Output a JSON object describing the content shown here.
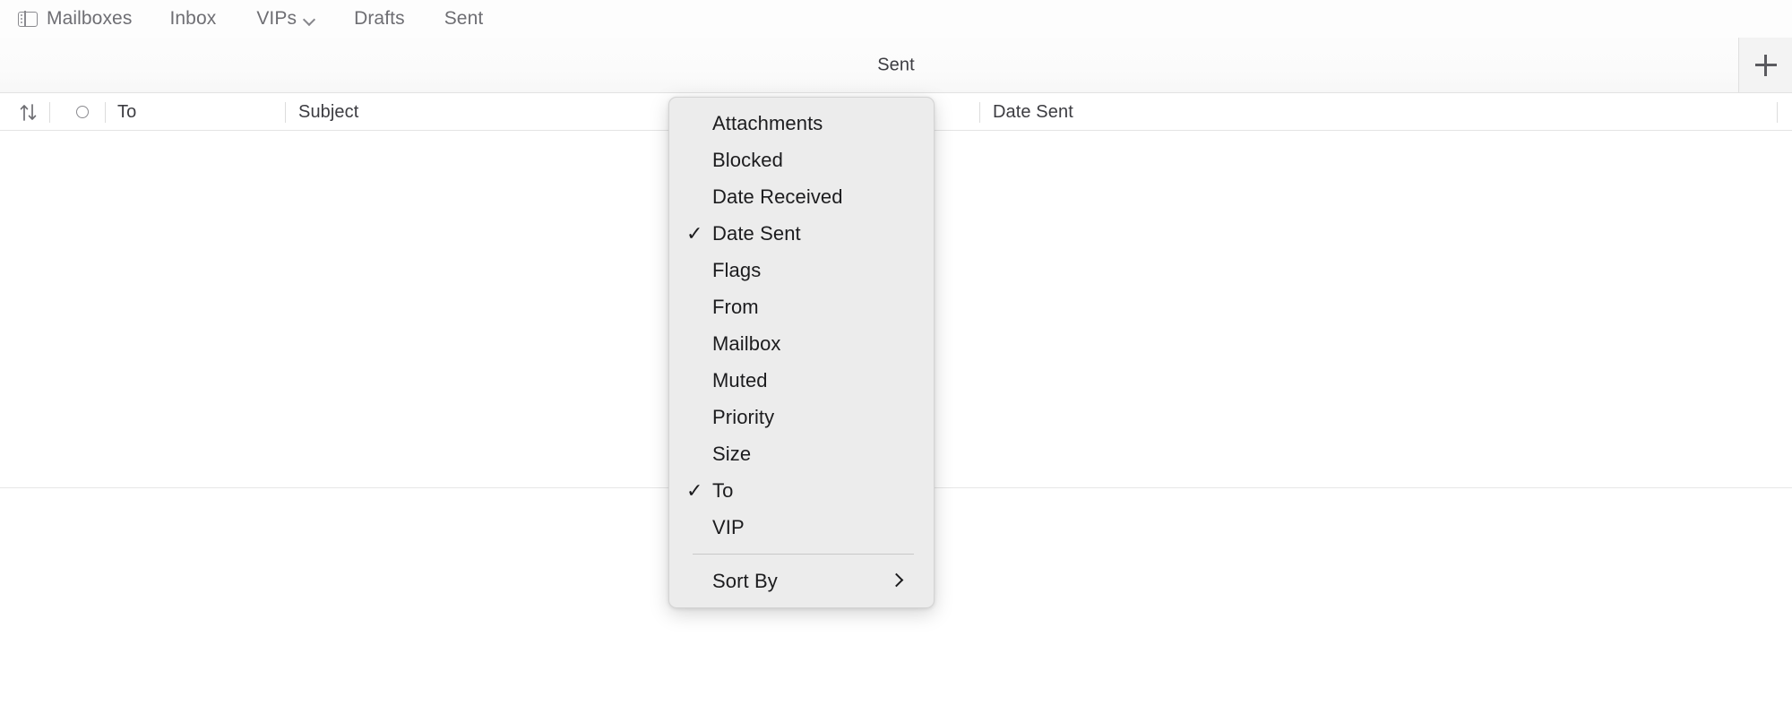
{
  "nav": {
    "items": [
      {
        "label": "Mailboxes",
        "icon": "sidebar-toggle-icon",
        "has_chevron": false
      },
      {
        "label": "Inbox",
        "icon": null,
        "has_chevron": false
      },
      {
        "label": "VIPs",
        "icon": null,
        "has_chevron": true
      },
      {
        "label": "Drafts",
        "icon": null,
        "has_chevron": false
      },
      {
        "label": "Sent",
        "icon": null,
        "has_chevron": false
      }
    ]
  },
  "titlebar": {
    "title": "Sent",
    "add_button_icon": "plus-icon",
    "add_button_label": "+"
  },
  "columns": {
    "sort_icon": "sort-arrows-icon",
    "unread_icon": "unread-circle-icon",
    "headers": [
      {
        "label": "To"
      },
      {
        "label": "Subject"
      },
      {
        "label": "Date Sent"
      }
    ]
  },
  "context_menu": {
    "items": [
      {
        "label": "Attachments",
        "checked": false
      },
      {
        "label": "Blocked",
        "checked": false
      },
      {
        "label": "Date Received",
        "checked": false
      },
      {
        "label": "Date Sent",
        "checked": true
      },
      {
        "label": "Flags",
        "checked": false
      },
      {
        "label": "From",
        "checked": false
      },
      {
        "label": "Mailbox",
        "checked": false
      },
      {
        "label": "Muted",
        "checked": false
      },
      {
        "label": "Priority",
        "checked": false
      },
      {
        "label": "Size",
        "checked": false
      },
      {
        "label": "To",
        "checked": true
      },
      {
        "label": "VIP",
        "checked": false
      }
    ],
    "submenu": {
      "label": "Sort By",
      "chevron": "chevron-right-icon"
    },
    "check_glyph": "✓"
  },
  "colors": {
    "window_bg": "#ffffff",
    "menu_bg": "#ececec",
    "nav_text": "#6e6e73",
    "header_text": "#3c3c41",
    "menu_text": "#1c1c1e",
    "divider": "#e4e4e4"
  }
}
